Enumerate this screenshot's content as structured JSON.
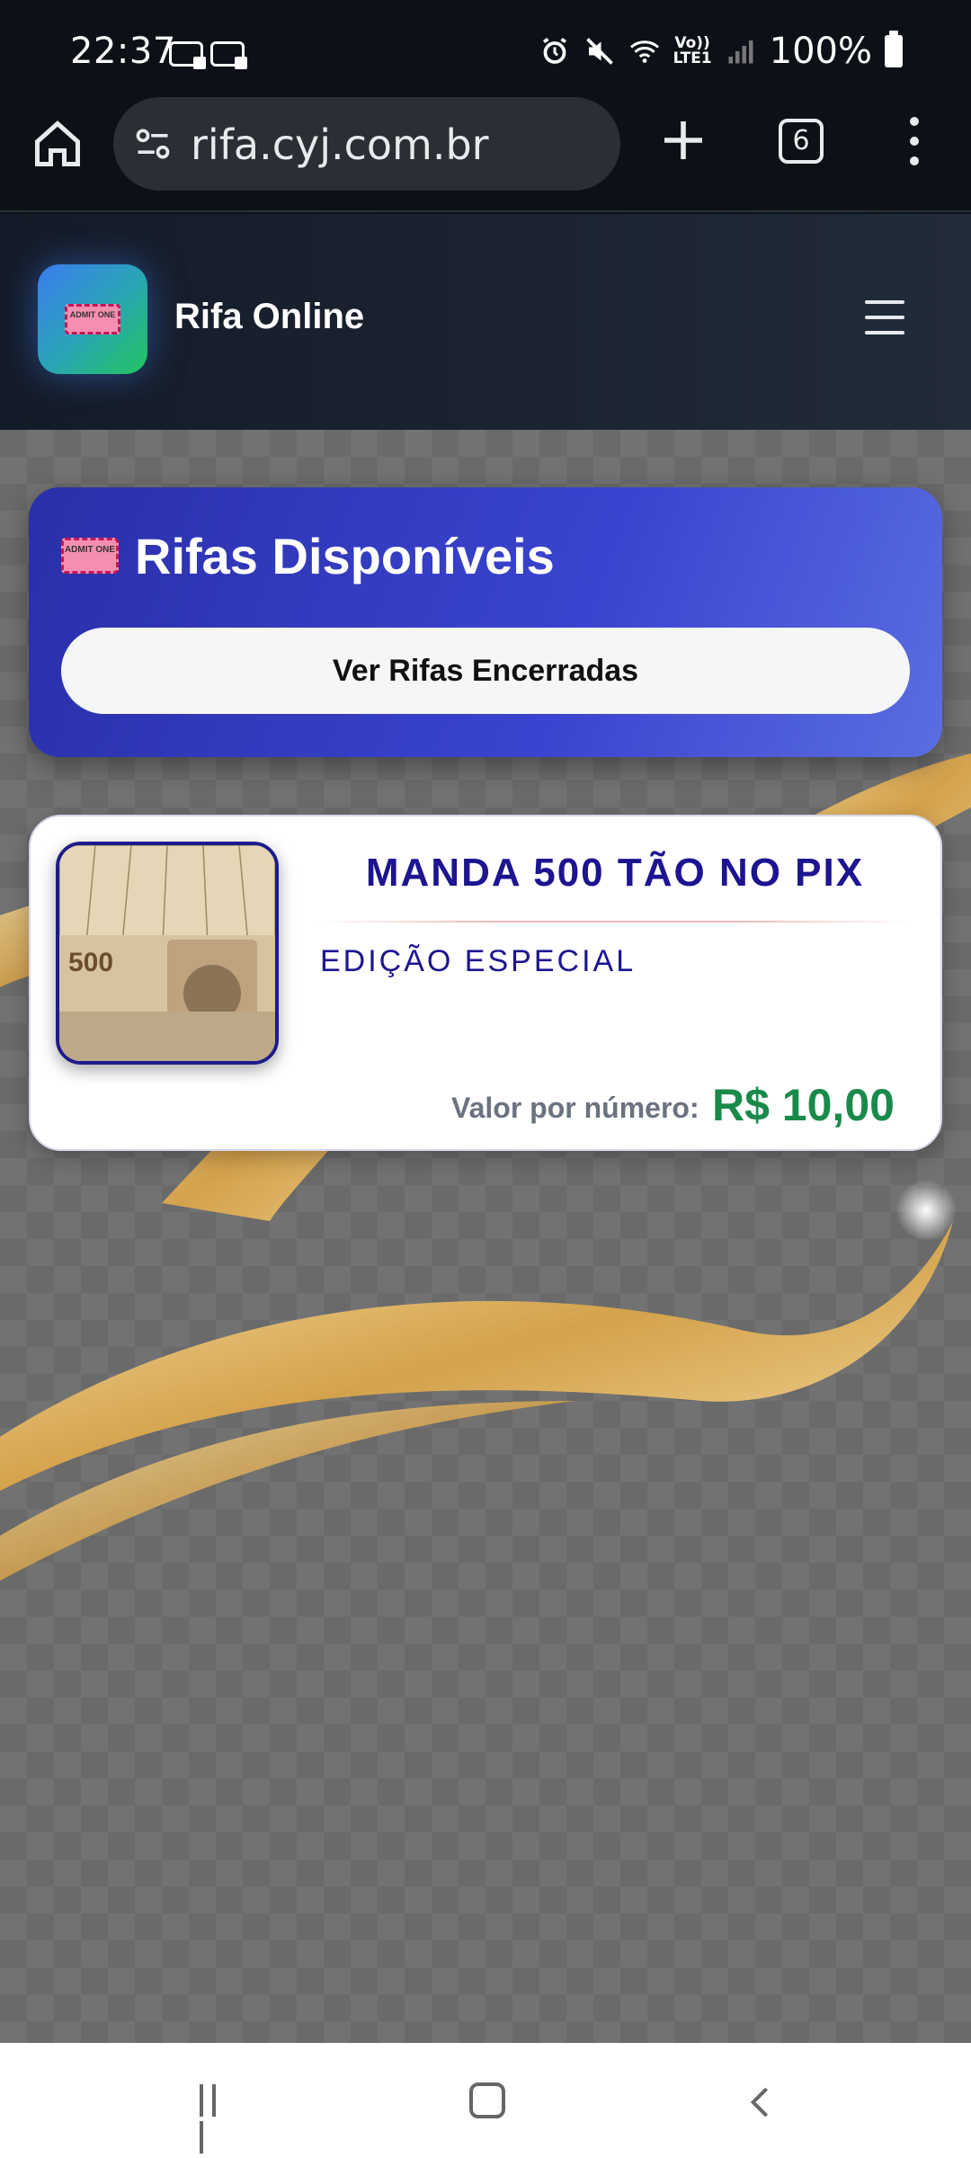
{
  "status_bar": {
    "time": "22:37",
    "battery": "100%",
    "network": "LTE1",
    "volte": "Vo))",
    "icons": [
      "voicemail-icon",
      "voicemail-icon",
      "alarm-icon",
      "mute-icon",
      "wifi-icon",
      "signal-icon",
      "battery-icon"
    ]
  },
  "browser": {
    "url": "rifa.cyj.com.br",
    "tab_count": "6",
    "icons": [
      "home-icon",
      "site-settings-icon",
      "plus-icon",
      "tabs-icon",
      "more-icon"
    ]
  },
  "header": {
    "site_title": "Rifa Online",
    "logo_text": "ADMIT ONE",
    "icons": [
      "ticket-icon",
      "hamburger-icon"
    ]
  },
  "hero": {
    "icon_text": "ADMIT ONE",
    "title": "Rifas Disponíveis",
    "closed_button": "Ver Rifas Encerradas"
  },
  "raffles": [
    {
      "title": "MANDA 500 TÃO NO PIX",
      "subtitle": "EDIÇÃO ESPECIAL",
      "price_label": "Valor por número:",
      "price": "R$ 10,00",
      "thumb_text": "500"
    }
  ],
  "colors": {
    "hero_gradient_start": "#2a2fa8",
    "hero_gradient_end": "#5a6ee0",
    "title_text": "#1c1490",
    "price_green": "#1a8a4a",
    "logo_gradient_start": "#3b7cf0",
    "logo_gradient_end": "#22c55e"
  },
  "nav": {
    "icons": [
      "recent-apps-icon",
      "home-nav-icon",
      "back-icon"
    ]
  }
}
